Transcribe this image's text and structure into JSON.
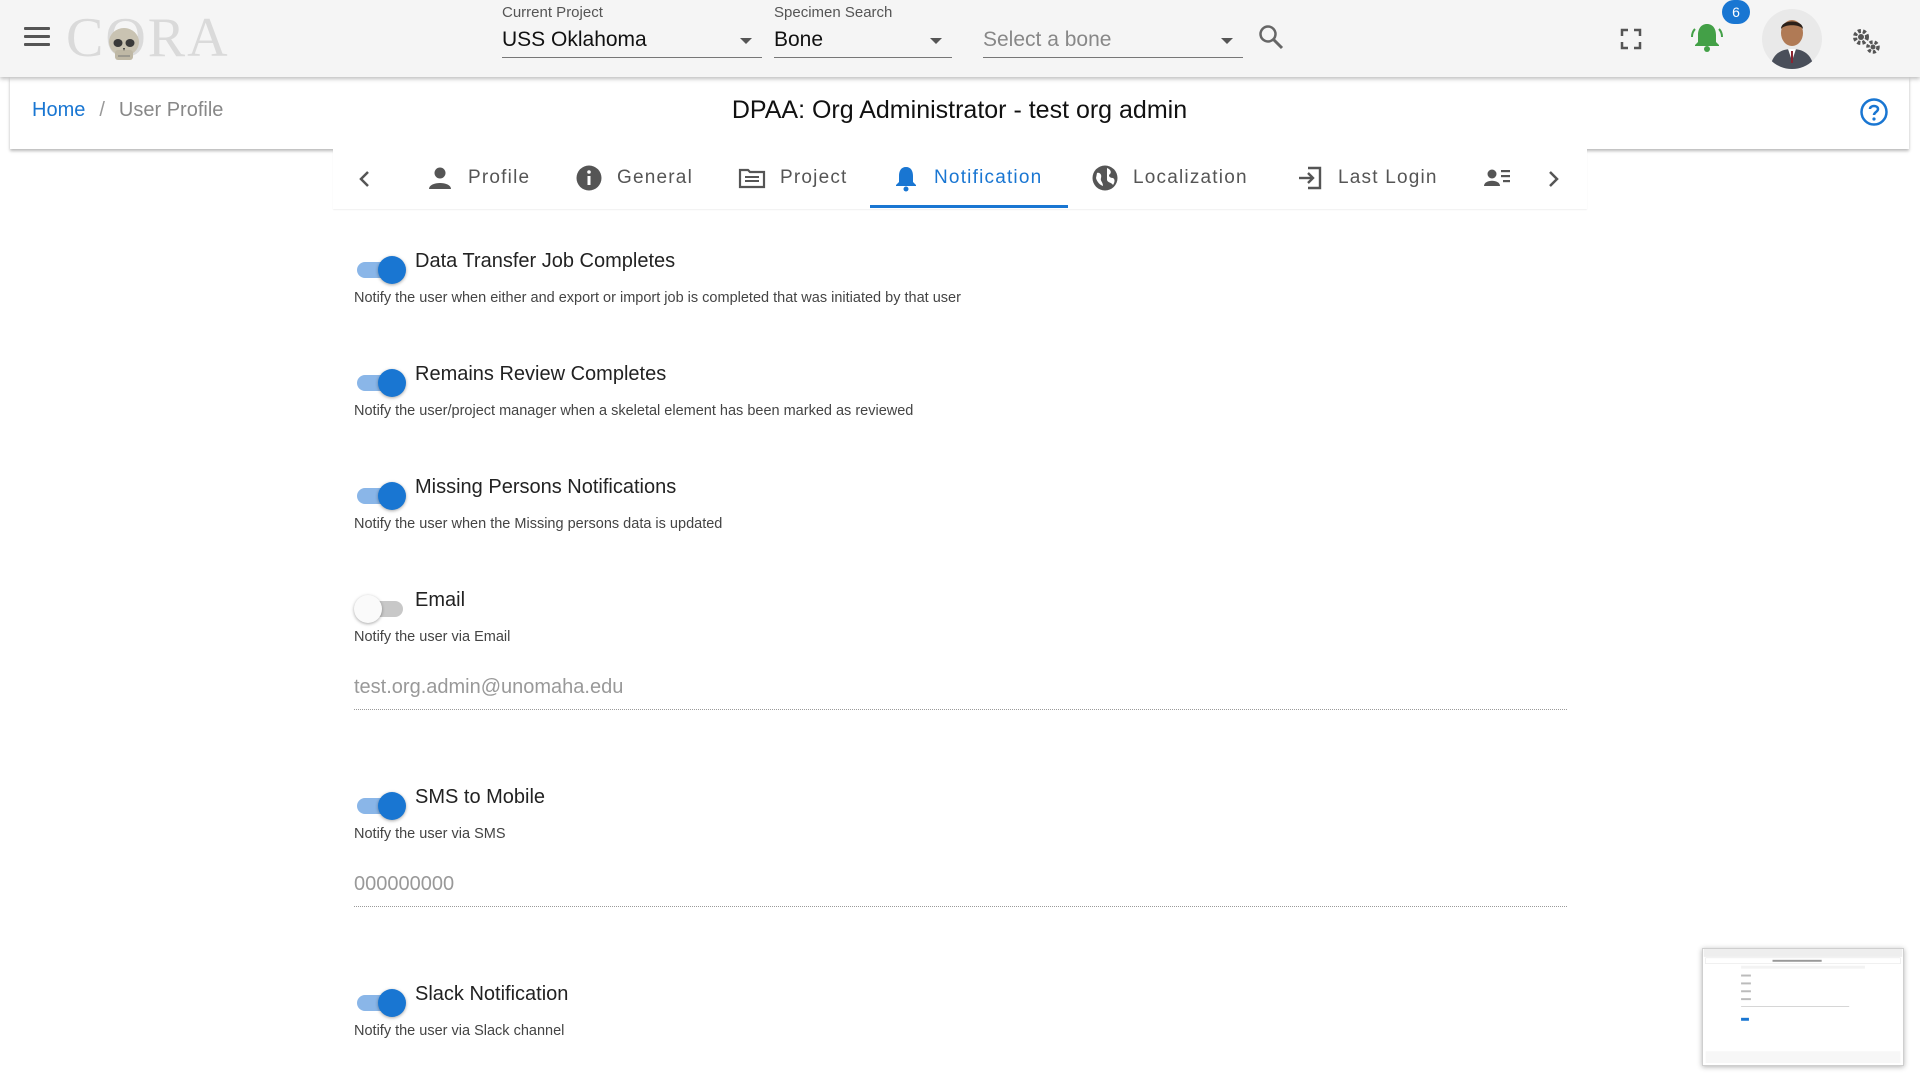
{
  "topbar": {
    "logo_text": "CORA",
    "current_project": {
      "label": "Current Project",
      "value": "USS Oklahoma"
    },
    "specimen_search": {
      "label": "Specimen Search",
      "value": "Bone"
    },
    "bone_select": {
      "placeholder": "Select a bone"
    },
    "notification_count": "6",
    "icons": [
      "menu-icon",
      "search-icon",
      "fullscreen-icon",
      "bell-icon",
      "avatar",
      "gears-icon"
    ],
    "bell_color": "#43a047"
  },
  "breadcrumb": {
    "home": "Home",
    "separator": "/",
    "current": "User Profile"
  },
  "page_title": "DPAA: Org Administrator - test org admin",
  "tabs": [
    {
      "label": "Profile",
      "icon": "person-icon"
    },
    {
      "label": "General",
      "icon": "info-icon"
    },
    {
      "label": "Project",
      "icon": "project-icon"
    },
    {
      "label": "Notification",
      "icon": "bell-icon",
      "active": true
    },
    {
      "label": "Localization",
      "icon": "globe-icon"
    },
    {
      "label": "Last Login",
      "icon": "login-icon"
    },
    {
      "label": "",
      "icon": "person-list-icon"
    }
  ],
  "settings": [
    {
      "title": "Data Transfer Job Completes",
      "desc": "Notify the user when either and export or import job is completed that was initiated by that user",
      "enabled": true
    },
    {
      "title": "Remains Review Completes",
      "desc": "Notify the user/project manager when a skeletal element has been marked as reviewed",
      "enabled": true
    },
    {
      "title": "Missing Persons Notifications",
      "desc": "Notify the user when the Missing persons data is updated",
      "enabled": true
    },
    {
      "title": "Email",
      "desc": "Notify the user via Email",
      "enabled": false,
      "value": "test.org.admin@unomaha.edu"
    },
    {
      "title": "SMS to Mobile",
      "desc": "Notify the user via SMS",
      "enabled": true,
      "value": "000000000"
    },
    {
      "title": "Slack Notification",
      "desc": "Notify the user via Slack channel",
      "enabled": true
    }
  ],
  "colors": {
    "accent": "#1976d2",
    "toggle_track_on": "#8ab6e8",
    "topbar_bg": "#f5f5f5"
  }
}
